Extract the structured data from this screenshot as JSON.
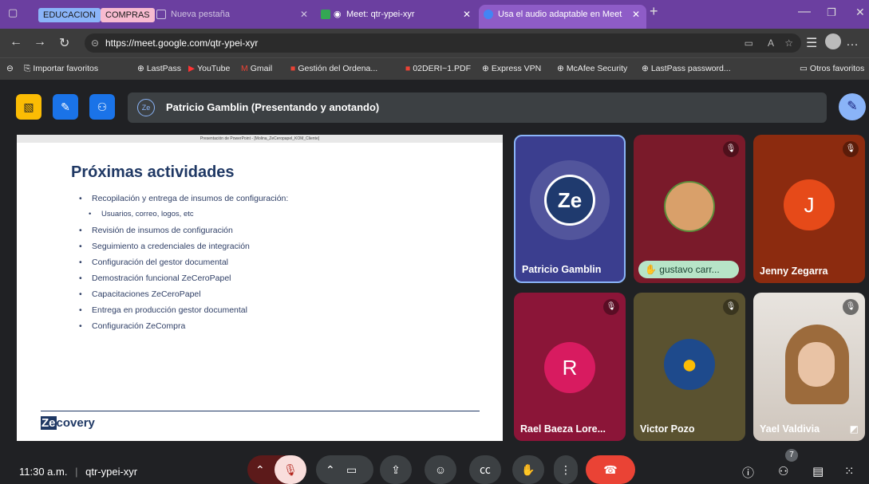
{
  "browser": {
    "tab_groups": [
      "EDUCACION",
      "COMPRAS"
    ],
    "tabs": [
      {
        "title": "Nueva pestaña"
      },
      {
        "title": "Meet: qtr-ypei-xyr"
      },
      {
        "title": "Usa el audio adaptable en Meet"
      }
    ],
    "url": "https://meet.google.com/qtr-ypei-xyr",
    "bookmarks": [
      "Importar favoritos",
      "LastPass",
      "YouTube",
      "Gmail",
      "Gestión del Ordena...",
      "02DERI~1.PDF",
      "Express VPN",
      "McAfee Security",
      "LastPass password...",
      "Otros favoritos"
    ]
  },
  "meet": {
    "presenter_initials": "Ze",
    "presenter_label": "Patricio Gamblin (Presentando y anotando)",
    "slide": {
      "window_title": "Presentación de PowerPoint - [Molina_ZeCeropapel_KOM_Cliente]",
      "title": "Próximas actividades",
      "bullets": [
        {
          "text": "Recopilación y entrega de insumos de configuración:",
          "sub": false
        },
        {
          "text": "Usuarios, correo, logos, etc",
          "sub": true
        },
        {
          "text": "Revisión de insumos de configuración",
          "sub": false
        },
        {
          "text": "Seguimiento a credenciales de integración",
          "sub": false
        },
        {
          "text": "Configuración del gestor documental",
          "sub": false
        },
        {
          "text": "Demostración funcional ZeCeroPapel",
          "sub": false
        },
        {
          "text": "Capacitaciones ZeCeroPapel",
          "sub": false
        },
        {
          "text": "Entrega en producción gestor documental",
          "sub": false
        },
        {
          "text": "Configuración ZeCompra",
          "sub": false
        }
      ],
      "logo_first": "Ze",
      "logo_rest": "covery"
    },
    "participants": {
      "patricio": {
        "name": "Patricio Gamblin",
        "initials": "Ze"
      },
      "gustavo": {
        "name": "gustavo carr..."
      },
      "jenny": {
        "name": "Jenny Zegarra",
        "initial": "J"
      },
      "rael": {
        "name": "Rael Baeza Lore...",
        "initial": "R"
      },
      "victor": {
        "name": "Victor Pozo"
      },
      "yael": {
        "name": "Yael Valdivia"
      }
    },
    "bottom": {
      "time": "11:30 a.m.",
      "meeting_code": "qtr-ypei-xyr",
      "people_count": "7"
    }
  },
  "colors": {
    "tabbar": "#6b3fa0",
    "meet_bg": "#202124",
    "end_call": "#ea4335",
    "accent": "#8ab4f8"
  }
}
